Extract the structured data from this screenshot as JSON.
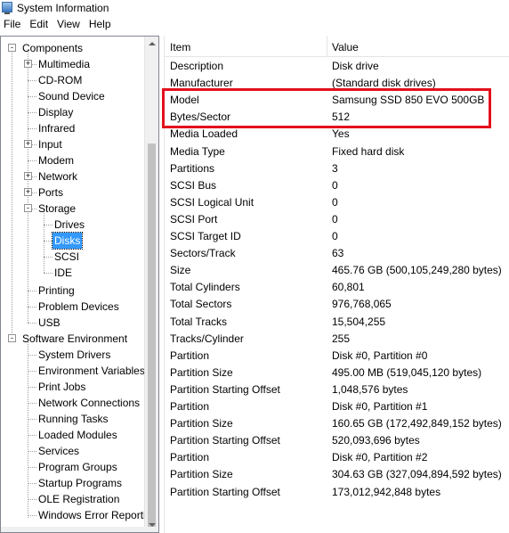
{
  "window": {
    "title": "System Information"
  },
  "menu": [
    "File",
    "Edit",
    "View",
    "Help"
  ],
  "tree": [
    {
      "label": "Components",
      "expander": "-"
    },
    {
      "label": "Multimedia",
      "expander": "+"
    },
    {
      "label": "CD-ROM"
    },
    {
      "label": "Sound Device"
    },
    {
      "label": "Display"
    },
    {
      "label": "Infrared"
    },
    {
      "label": "Input",
      "expander": "+"
    },
    {
      "label": "Modem"
    },
    {
      "label": "Network",
      "expander": "+"
    },
    {
      "label": "Ports",
      "expander": "+"
    },
    {
      "label": "Storage",
      "expander": "-"
    },
    {
      "label": "Drives"
    },
    {
      "label": "Disks",
      "selected": true
    },
    {
      "label": "SCSI"
    },
    {
      "label": "IDE"
    },
    {
      "label": "Printing"
    },
    {
      "label": "Problem Devices"
    },
    {
      "label": "USB"
    },
    {
      "label": "Software Environment",
      "expander": "-"
    },
    {
      "label": "System Drivers"
    },
    {
      "label": "Environment Variables"
    },
    {
      "label": "Print Jobs"
    },
    {
      "label": "Network Connections"
    },
    {
      "label": "Running Tasks"
    },
    {
      "label": "Loaded Modules"
    },
    {
      "label": "Services"
    },
    {
      "label": "Program Groups"
    },
    {
      "label": "Startup Programs"
    },
    {
      "label": "OLE Registration"
    },
    {
      "label": "Windows Error Reporti"
    }
  ],
  "list": {
    "columns": [
      "Item",
      "Value"
    ],
    "rows": [
      [
        "Description",
        "Disk drive"
      ],
      [
        "Manufacturer",
        "(Standard disk drives)"
      ],
      [
        "Model",
        "Samsung SSD 850 EVO 500GB"
      ],
      [
        "Bytes/Sector",
        "512"
      ],
      [
        "Media Loaded",
        "Yes"
      ],
      [
        "Media Type",
        "Fixed hard disk"
      ],
      [
        "Partitions",
        "3"
      ],
      [
        "SCSI Bus",
        "0"
      ],
      [
        "SCSI Logical Unit",
        "0"
      ],
      [
        "SCSI Port",
        "0"
      ],
      [
        "SCSI Target ID",
        "0"
      ],
      [
        "Sectors/Track",
        "63"
      ],
      [
        "Size",
        "465.76 GB (500,105,249,280 bytes)"
      ],
      [
        "Total Cylinders",
        "60,801"
      ],
      [
        "Total Sectors",
        "976,768,065"
      ],
      [
        "Total Tracks",
        "15,504,255"
      ],
      [
        "Tracks/Cylinder",
        "255"
      ],
      [
        "Partition",
        "Disk #0, Partition #0"
      ],
      [
        "Partition Size",
        "495.00 MB (519,045,120 bytes)"
      ],
      [
        "Partition Starting Offset",
        "1,048,576 bytes"
      ],
      [
        "Partition",
        "Disk #0, Partition #1"
      ],
      [
        "Partition Size",
        "160.65 GB (172,492,849,152 bytes)"
      ],
      [
        "Partition Starting Offset",
        "520,093,696 bytes"
      ],
      [
        "Partition",
        "Disk #0, Partition #2"
      ],
      [
        "Partition Size",
        "304.63 GB (327,094,894,592 bytes)"
      ],
      [
        "Partition Starting Offset",
        "173,012,942,848 bytes"
      ]
    ]
  },
  "colors": {
    "selection": "#3399ff",
    "highlight_border": "#e3101c"
  }
}
